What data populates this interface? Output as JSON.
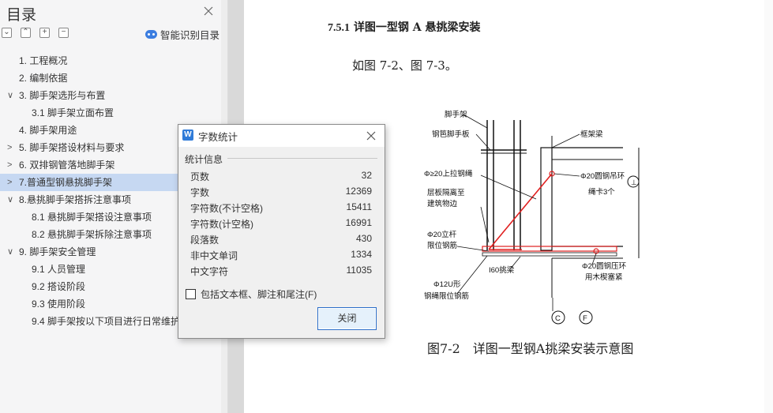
{
  "sidebar": {
    "title": "目录",
    "smart_label": "智能识别目录",
    "items": [
      {
        "label": "1. 工程概况",
        "indent": 1,
        "arrow": ""
      },
      {
        "label": "2. 编制依据",
        "indent": 1,
        "arrow": ""
      },
      {
        "label": "3. 脚手架选形与布置",
        "indent": 1,
        "arrow": "∨"
      },
      {
        "label": "3.1 脚手架立面布置",
        "indent": 2,
        "arrow": ""
      },
      {
        "label": "4. 脚手架用途",
        "indent": 1,
        "arrow": ""
      },
      {
        "label": "5. 脚手架搭设材料与要求",
        "indent": 1,
        "arrow": ">"
      },
      {
        "label": "6. 双排钢管落地脚手架",
        "indent": 1,
        "arrow": ">"
      },
      {
        "label": "7.普通型钢悬挑脚手架",
        "indent": 1,
        "arrow": ">"
      },
      {
        "label": "8.悬挑脚手架搭拆注意事项",
        "indent": 1,
        "arrow": "∨"
      },
      {
        "label": "8.1 悬挑脚手架搭设注意事项",
        "indent": 2,
        "arrow": ""
      },
      {
        "label": "8.2 悬挑脚手架拆除注意事项",
        "indent": 2,
        "arrow": ""
      },
      {
        "label": "9. 脚手架安全管理",
        "indent": 1,
        "arrow": "∨"
      },
      {
        "label": "9.1 人员管理",
        "indent": 2,
        "arrow": ""
      },
      {
        "label": "9.2 搭设阶段",
        "indent": 2,
        "arrow": ""
      },
      {
        "label": "9.3 使用阶段",
        "indent": 2,
        "arrow": ""
      },
      {
        "label": "9.4 脚手架按以下项目进行日常维护",
        "indent": 2,
        "arrow": ""
      }
    ]
  },
  "document": {
    "heading_num": "7.5.1",
    "heading_text": "详图一型钢 A 悬挑梁安装",
    "paragraph": "如图 7-2、图 7-3。",
    "caption": "图7-2　详图一型钢A挑梁安装示意图",
    "figure_labels": {
      "l1": "脚手架",
      "l2": "钢笆脚手板",
      "l3": "框架梁",
      "l4": "Φ≥20上拉钢绳",
      "l5": "Φ20圆钢吊环",
      "l6": "绳卡3个",
      "l7": "层板隔离至",
      "l8": "建筑物边",
      "l9": "Φ20立杆",
      "l10": "限位钢筋",
      "l11": "I60挑梁",
      "l12": "Φ20圆钢压环",
      "l13": "用木楔塞紧",
      "l14": "Φ12U形",
      "l15": "钢绳限位钢筋",
      "axis_c": "C",
      "axis_f": "F",
      "axis_mark": "⊥"
    }
  },
  "dialog": {
    "title": "字数统计",
    "group_title": "统计信息",
    "stats": [
      {
        "key": "页数",
        "value": "32"
      },
      {
        "key": "字数",
        "value": "12369"
      },
      {
        "key": "字符数(不计空格)",
        "value": "15411"
      },
      {
        "key": "字符数(计空格)",
        "value": "16991"
      },
      {
        "key": "段落数",
        "value": "430"
      },
      {
        "key": "非中文单词",
        "value": "1334"
      },
      {
        "key": "中文字符",
        "value": "11035"
      }
    ],
    "checkbox_label": "包括文本框、脚注和尾注(F)",
    "checkbox_checked": false,
    "close_button": "关闭"
  },
  "colors": {
    "active_toc": "#c6d8f2",
    "accent": "#2f7bd8",
    "figure_red": "#e02020"
  }
}
